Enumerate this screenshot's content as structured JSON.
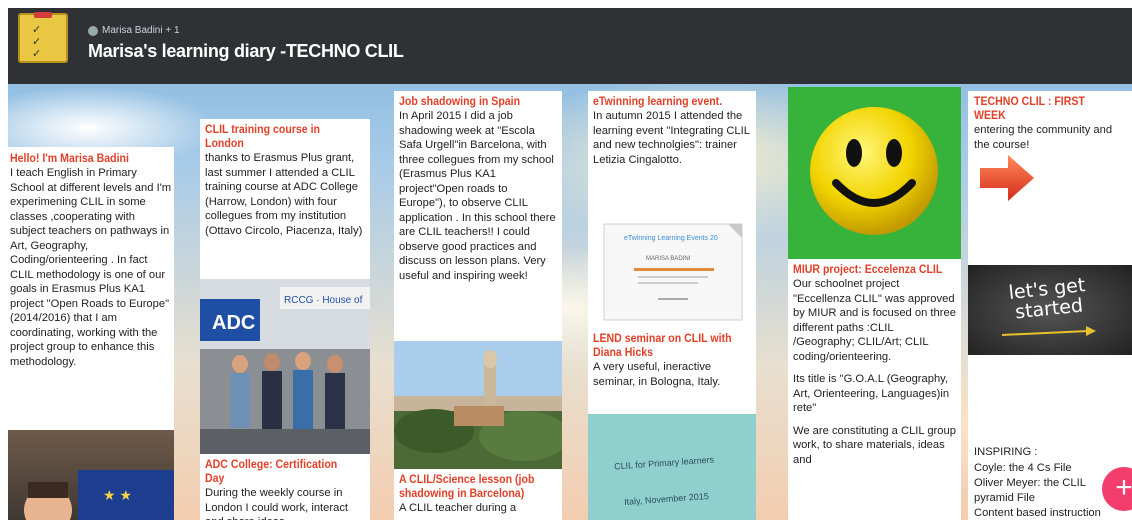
{
  "header": {
    "author": "Marisa Badini + 1",
    "title": "Marisa's learning diary -TECHNO CLIL"
  },
  "cards": {
    "c1": {
      "title": "Hello! I'm Marisa Badini",
      "body": "I teach English in Primary School at different levels and I'm experimening  CLIL in some classes ,cooperating with subject teachers on pathways in Art, Geography, Coding/orienteering . In fact CLIL methodology is one of our goals in Erasmus Plus KA1 project \"Open Roads to Europe\" (2014/2016) that I am coordinating, working with the project group to enhance this methodology."
    },
    "c2": {
      "title": "CLIL training course in London",
      "body": "thanks to Erasmus Plus grant, last summer I attended a CLIL training course at ADC College (Harrow, London) with four collegues from my institution (Ottavo Circolo, Piacenza, Italy)"
    },
    "c2b": {
      "title": "ADC College: Certification Day",
      "body": "During the weekly course in London I could work, interact and share ideas"
    },
    "c3": {
      "title": "Job shadowing in Spain",
      "body": "In April 2015 I did a job shadowing week at \"Escola Safa Urgell\"in Barcelona, with three collegues from my school (Erasmus Plus KA1 project\"Open roads to Europe\"), to observe CLIL application . In this school there are CLIL  teachers!! I could observe good practices and discuss on lesson plans. Very useful and inspiring week!"
    },
    "c3b": {
      "title": "A CLIL/Science lesson (job shadowing in Barcelona)",
      "body": "A CLIL teacher during a"
    },
    "c4": {
      "title": "eTwinning learning event.",
      "body": "In autumn 2015 I attended the learning event \"Integrating CLIL and new technolgies\":  trainer Letizia Cingalotto."
    },
    "c4cert": {
      "heading": "eTwinning Learning Events 20",
      "name": "MARISA BADINI"
    },
    "c4b": {
      "title": "LEND seminar on CLIL with Diana Hicks",
      "body": "A very useful, ineractive seminar, in Bologna, Italy."
    },
    "c4slide": {
      "line1": "CLIL for Primary learners",
      "line2": "Italy, November 2015"
    },
    "c5": {
      "title": "MIUR project: Eccelenza CLIL",
      "body1": " Our  schoolnet project \"Eccellenza CLIL\" was approved by MIUR and is focused on three different paths :CLIL /Geography; CLIL/Art; CLIL coding/orienteering.",
      "body2": "Its title is \"G.O.A.L (Geography, Art, Orienteering, Languages)in rete\"",
      "body3": "We are constituting a CLIL group work, to share materials, ideas and"
    },
    "c6": {
      "title": "TECHNO CLIL : FIRST WEEK",
      "body": " entering the community and the course!"
    },
    "c6img": {
      "text": "let's get started"
    },
    "c6b": {
      "label": "INSPIRING :",
      "link1": " Coyle: the 4 Cs File",
      "link2": "Oliver Meyer: the CLIL pyramid File",
      "link3": "Content  based instruction"
    }
  },
  "photos": {
    "adc_sign": "ADC",
    "rccg_sign": "RCCG · House of"
  },
  "fab": {
    "label": "+"
  },
  "colors": {
    "header_bg": "#2f3135",
    "title_red": "#e0412a",
    "link_pink": "#e0307a",
    "fab": "#f23d6d"
  }
}
